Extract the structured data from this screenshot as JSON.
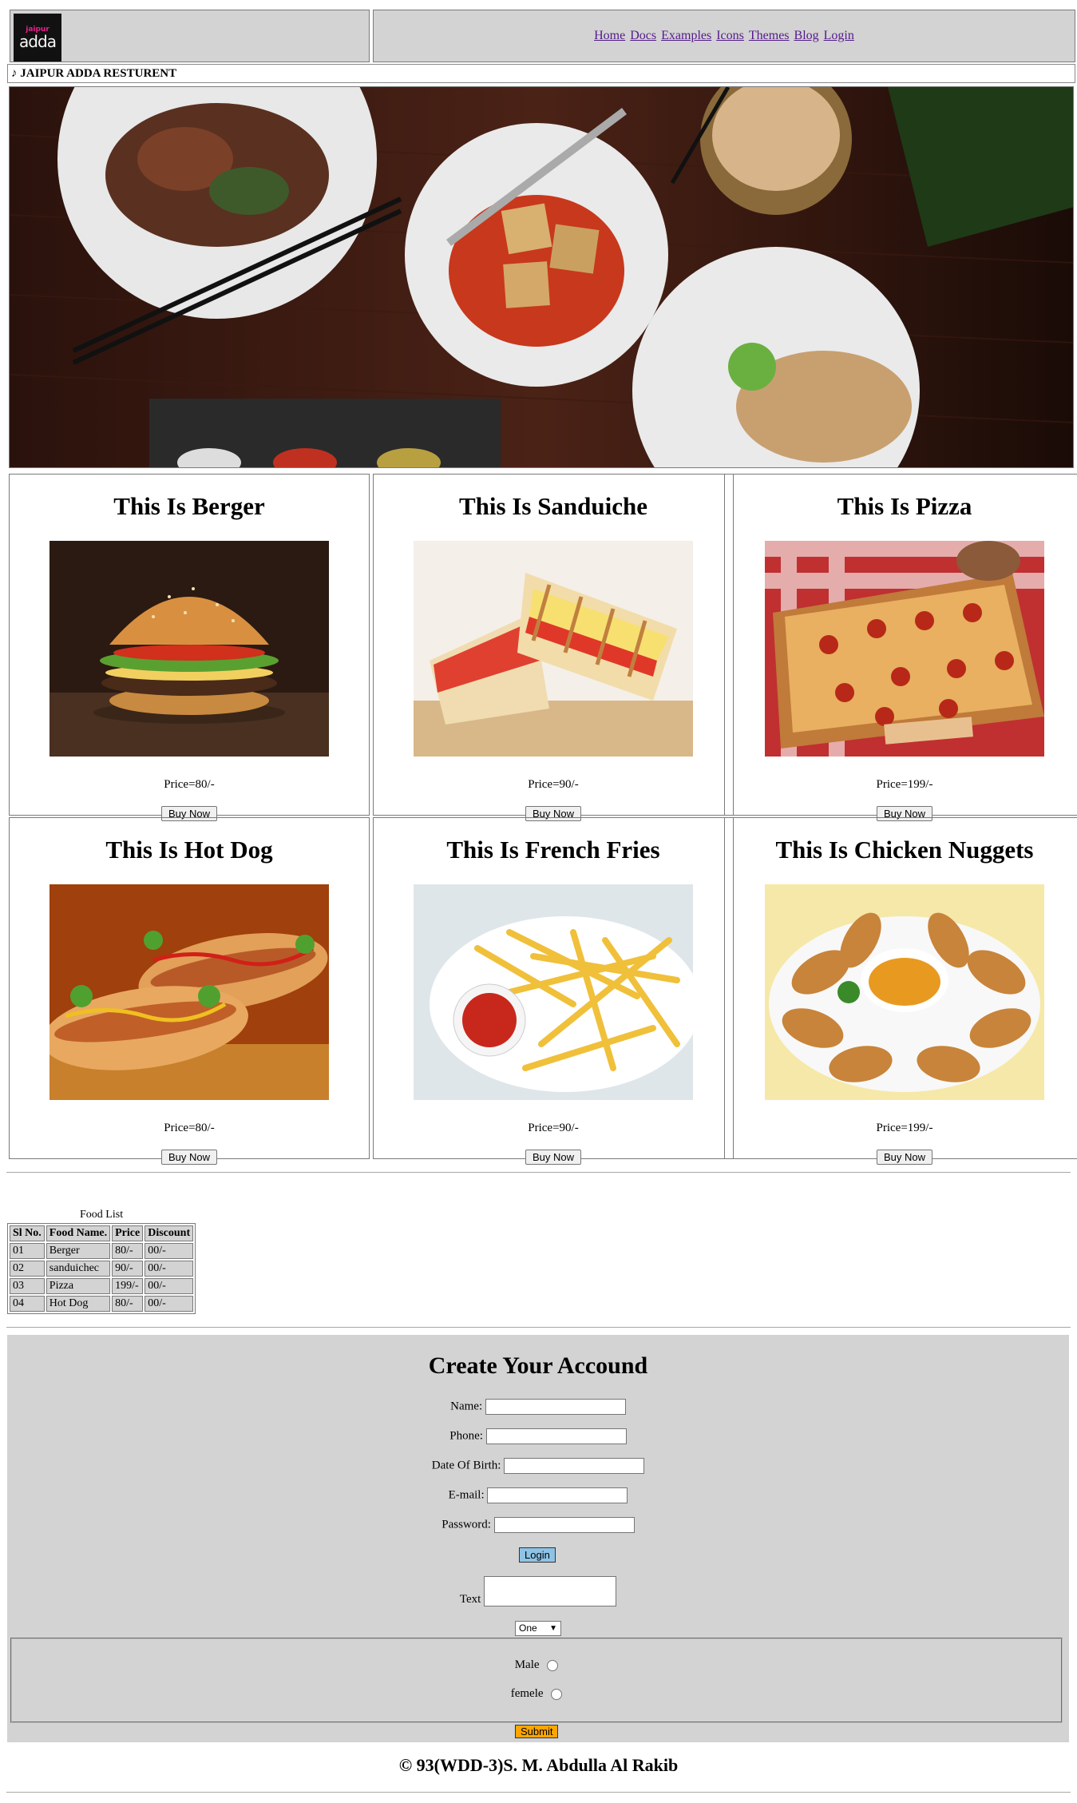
{
  "header": {
    "logo_text_top": "jaipur",
    "logo_text_main": "adda",
    "nav": [
      "Home",
      "Docs",
      "Examples",
      "Icons",
      "Themes",
      "Blog",
      "Login"
    ]
  },
  "brand": "JAIPUR ADDA RESTURENT",
  "products": [
    {
      "title": "This Is Berger",
      "price": "Price=80/-",
      "button": "Buy Now"
    },
    {
      "title": "This Is Sanduiche",
      "price": "Price=90/-",
      "button": "Buy Now"
    },
    {
      "title": "This Is Pizza",
      "price": "Price=199/-",
      "button": "Buy Now"
    },
    {
      "title": "This Is Hot Dog",
      "price": "Price=80/-",
      "button": "Buy Now"
    },
    {
      "title": "This Is French Fries",
      "price": "Price=90/-",
      "button": "Buy Now"
    },
    {
      "title": "This Is Chicken Nuggets",
      "price": "Price=199/-",
      "button": "Buy Now"
    }
  ],
  "food_list": {
    "caption": "Food List",
    "headers": [
      "Sl No.",
      "Food Name.",
      "Price",
      "Discount"
    ],
    "rows": [
      [
        "01",
        "Berger",
        "80/-",
        "00/-"
      ],
      [
        "02",
        "sanduichec",
        "90/-",
        "00/-"
      ],
      [
        "03",
        "Pizza",
        "199/-",
        "00/-"
      ],
      [
        "04",
        "Hot Dog",
        "80/-",
        "00/-"
      ]
    ]
  },
  "form": {
    "title": "Create Your Accound",
    "name_label": "Name:",
    "phone_label": "Phone:",
    "dob_label": "Date Of Birth:",
    "email_label": "E-mail:",
    "password_label": "Password:",
    "login_button": "Login",
    "text_label": "Text",
    "select_value": "One",
    "male_label": "Male",
    "female_label": "femele",
    "submit_button": "Submit"
  },
  "footer": "© 93(WDD-3)S. M. Abdulla Al Rakib"
}
